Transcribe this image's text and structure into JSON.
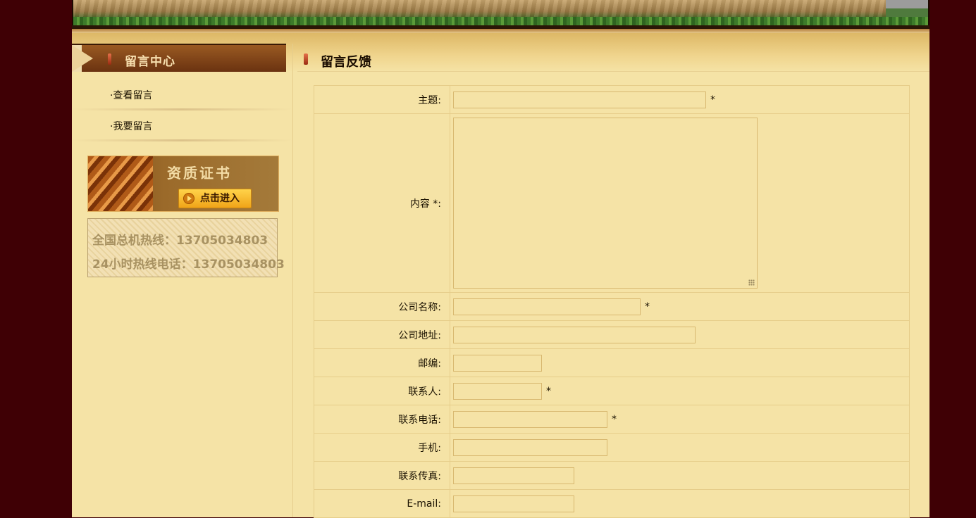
{
  "sidebar": {
    "title": "留言中心",
    "items": [
      {
        "label": "·查看留言"
      },
      {
        "label": "·我要留言"
      }
    ],
    "cert_banner": {
      "title": "资质证书",
      "button_label": "点击进入"
    },
    "hotline": {
      "line1": "全国总机热线：13705034803",
      "line2": "24小时热线电话：13705034803"
    }
  },
  "main": {
    "title": "留言反馈",
    "form": {
      "subject": {
        "label": "主题:",
        "value": "",
        "required": "*"
      },
      "content": {
        "label": "内容 *:",
        "value": ""
      },
      "company_name": {
        "label": "公司名称:",
        "value": "",
        "required": "*"
      },
      "company_address": {
        "label": "公司地址:",
        "value": ""
      },
      "postcode": {
        "label": "邮编:",
        "value": ""
      },
      "contact_person": {
        "label": "联系人:",
        "value": "",
        "required": "*"
      },
      "phone": {
        "label": "联系电话:",
        "value": "",
        "required": "*"
      },
      "mobile": {
        "label": "手机:",
        "value": ""
      },
      "fax": {
        "label": "联系传真:",
        "value": ""
      },
      "email": {
        "label": "E-mail:",
        "value": ""
      }
    }
  },
  "colors": {
    "page_bg": "#3f0005",
    "content_bg": "#f5e3a6",
    "header_brown": "#6a3210",
    "border": "#e6cd8a"
  }
}
